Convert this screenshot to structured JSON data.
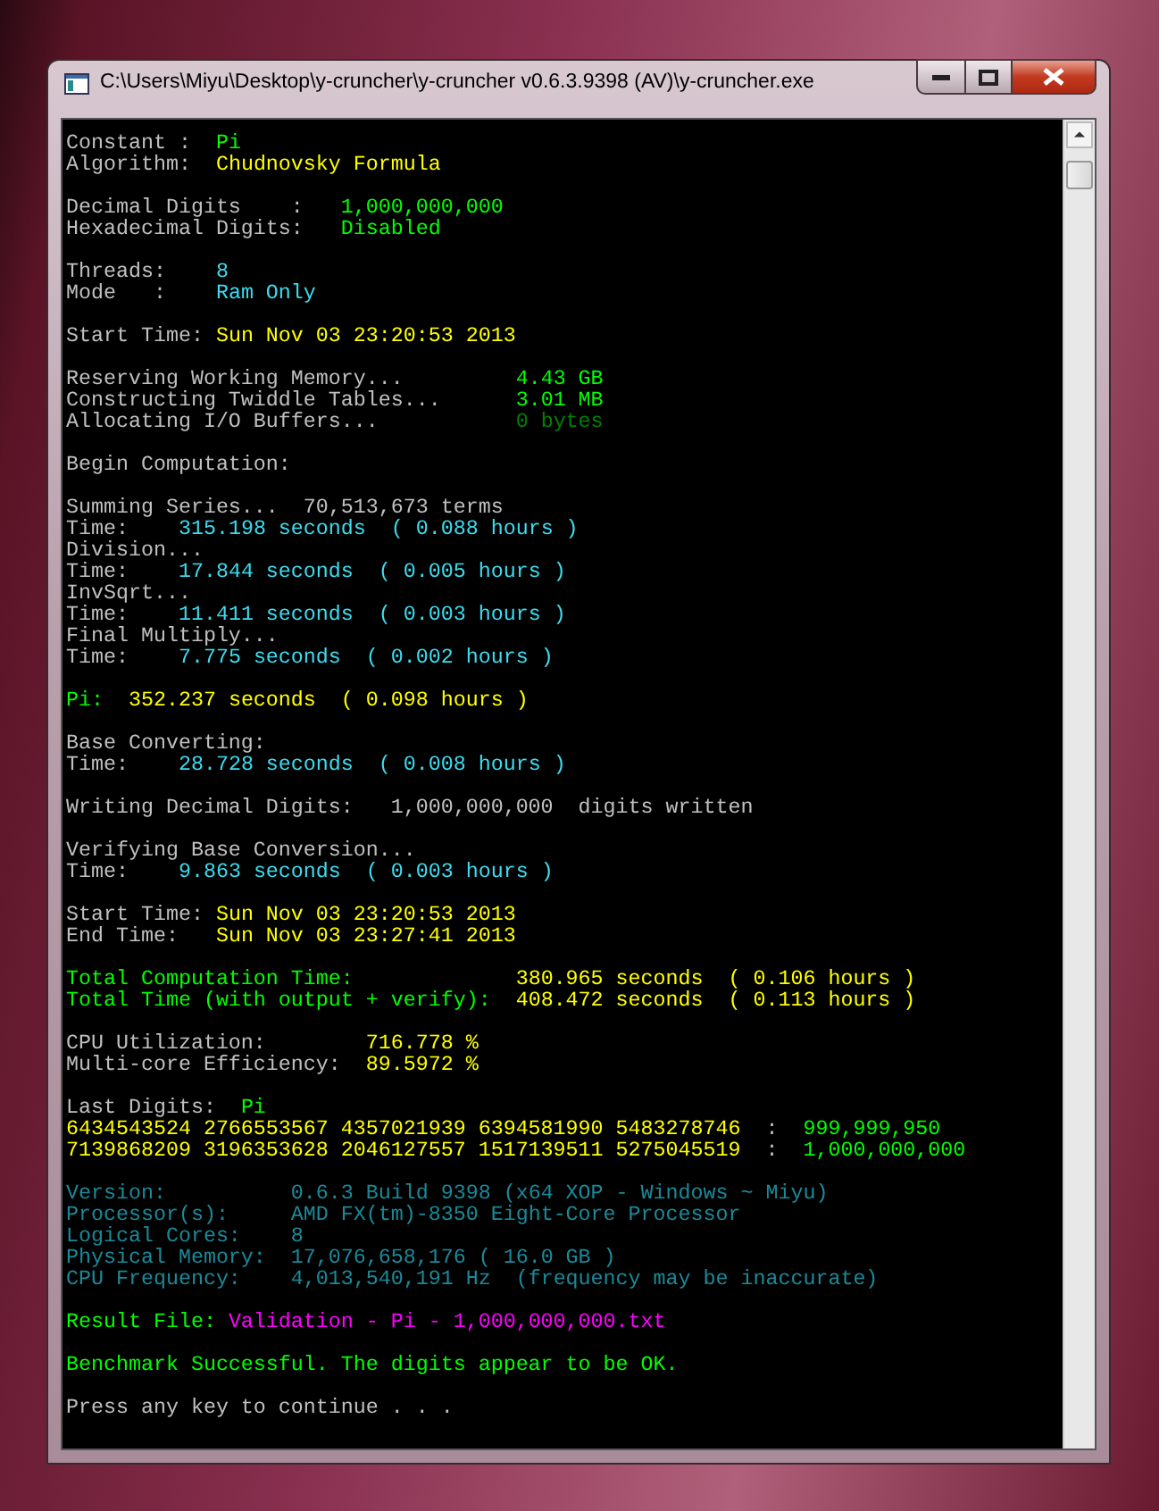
{
  "window": {
    "title": "C:\\Users\\Miyu\\Desktop\\y-cruncher\\y-cruncher v0.6.3.9398 (AV)\\y-cruncher.exe"
  },
  "console": {
    "blocks": [
      [
        [
          {
            "text": "Constant :  ",
            "color": "#c0c0c0"
          },
          {
            "text": "Pi",
            "color": "#00ff00"
          }
        ],
        [
          {
            "text": "Algorithm:  ",
            "color": "#c0c0c0"
          },
          {
            "text": "Chudnovsky Formula",
            "color": "#ffff00"
          }
        ]
      ],
      [
        [
          {
            "text": "Decimal Digits    :   ",
            "color": "#c0c0c0"
          },
          {
            "text": "1,000,000,000",
            "color": "#00ff00"
          }
        ],
        [
          {
            "text": "Hexadecimal Digits:   ",
            "color": "#c0c0c0"
          },
          {
            "text": "Disabled",
            "color": "#00ff00"
          }
        ]
      ],
      [
        [
          {
            "text": "Threads:    ",
            "color": "#c0c0c0"
          },
          {
            "text": "8",
            "color": "#3cdcf0"
          }
        ],
        [
          {
            "text": "Mode   :    ",
            "color": "#c0c0c0"
          },
          {
            "text": "Ram Only",
            "color": "#3cdcf0"
          }
        ]
      ],
      [
        [
          {
            "text": "Start Time: ",
            "color": "#c0c0c0"
          },
          {
            "text": "Sun Nov 03 23:20:53 2013",
            "color": "#ffff00"
          }
        ]
      ],
      [
        [
          {
            "text": "Reserving Working Memory...         ",
            "color": "#c0c0c0"
          },
          {
            "text": "4.43 GB",
            "color": "#00ff00"
          }
        ],
        [
          {
            "text": "Constructing Twiddle Tables...      ",
            "color": "#c0c0c0"
          },
          {
            "text": "3.01 MB",
            "color": "#00ff00"
          }
        ],
        [
          {
            "text": "Allocating I/O Buffers...           ",
            "color": "#c0c0c0"
          },
          {
            "text": "0 bytes",
            "color": "#008000"
          }
        ]
      ],
      [
        [
          {
            "text": "Begin Computation:",
            "color": "#c0c0c0"
          }
        ]
      ],
      [
        [
          {
            "text": "Summing Series...  70,513,673 terms",
            "color": "#c0c0c0"
          }
        ],
        [
          {
            "text": "Time:    ",
            "color": "#c0c0c0"
          },
          {
            "text": "315.198 seconds  ( 0.088 hours )",
            "color": "#3cdcf0"
          }
        ],
        [
          {
            "text": "Division...",
            "color": "#c0c0c0"
          }
        ],
        [
          {
            "text": "Time:    ",
            "color": "#c0c0c0"
          },
          {
            "text": "17.844 seconds  ( 0.005 hours )",
            "color": "#3cdcf0"
          }
        ],
        [
          {
            "text": "InvSqrt...",
            "color": "#c0c0c0"
          }
        ],
        [
          {
            "text": "Time:    ",
            "color": "#c0c0c0"
          },
          {
            "text": "11.411 seconds  ( 0.003 hours )",
            "color": "#3cdcf0"
          }
        ],
        [
          {
            "text": "Final Multiply...",
            "color": "#c0c0c0"
          }
        ],
        [
          {
            "text": "Time:    ",
            "color": "#c0c0c0"
          },
          {
            "text": "7.775 seconds  ( 0.002 hours )",
            "color": "#3cdcf0"
          }
        ]
      ],
      [
        [
          {
            "text": "Pi:  ",
            "color": "#00ff00"
          },
          {
            "text": "352.237 seconds  ( 0.098 hours )",
            "color": "#ffff00"
          }
        ]
      ],
      [
        [
          {
            "text": "Base Converting:",
            "color": "#c0c0c0"
          }
        ],
        [
          {
            "text": "Time:    ",
            "color": "#c0c0c0"
          },
          {
            "text": "28.728 seconds  ( 0.008 hours )",
            "color": "#3cdcf0"
          }
        ]
      ],
      [
        [
          {
            "text": "Writing Decimal Digits:   1,000,000,000  digits written",
            "color": "#c0c0c0"
          }
        ]
      ],
      [
        [
          {
            "text": "Verifying Base Conversion...",
            "color": "#c0c0c0"
          }
        ],
        [
          {
            "text": "Time:    ",
            "color": "#c0c0c0"
          },
          {
            "text": "9.863 seconds  ( 0.003 hours )",
            "color": "#3cdcf0"
          }
        ]
      ],
      [
        [
          {
            "text": "Start Time: ",
            "color": "#c0c0c0"
          },
          {
            "text": "Sun Nov 03 23:20:53 2013",
            "color": "#ffff00"
          }
        ],
        [
          {
            "text": "End Time:   ",
            "color": "#c0c0c0"
          },
          {
            "text": "Sun Nov 03 23:27:41 2013",
            "color": "#ffff00"
          }
        ]
      ],
      [
        [
          {
            "text": "Total Computation Time:             ",
            "color": "#00ff00"
          },
          {
            "text": "380.965 seconds  ( 0.106 hours )",
            "color": "#ffff00"
          }
        ],
        [
          {
            "text": "Total Time (with output + verify):  ",
            "color": "#00ff00"
          },
          {
            "text": "408.472 seconds  ( 0.113 hours )",
            "color": "#ffff00"
          }
        ]
      ],
      [
        [
          {
            "text": "CPU Utilization:        ",
            "color": "#c0c0c0"
          },
          {
            "text": "716.778 %",
            "color": "#ffff00"
          }
        ],
        [
          {
            "text": "Multi-core Efficiency:  ",
            "color": "#c0c0c0"
          },
          {
            "text": "89.5972 %",
            "color": "#ffff00"
          }
        ]
      ],
      [
        [
          {
            "text": "Last Digits:  ",
            "color": "#c0c0c0"
          },
          {
            "text": "Pi",
            "color": "#00ff00"
          }
        ],
        [
          {
            "text": "6434543524 2766553567 4357021939 6394581990 5483278746",
            "color": "#ffff00"
          },
          {
            "text": "  :  ",
            "color": "#c0c0c0"
          },
          {
            "text": "999,999,950",
            "color": "#00ff00"
          }
        ],
        [
          {
            "text": "7139868209 3196353628 2046127557 1517139511 5275045519",
            "color": "#ffff00"
          },
          {
            "text": "  :  ",
            "color": "#c0c0c0"
          },
          {
            "text": "1,000,000,000",
            "color": "#00ff00"
          }
        ]
      ],
      [
        [
          {
            "text": "Version:          ",
            "color": "#1a8a9a"
          },
          {
            "text": "0.6.3 Build 9398 (x64 XOP - Windows ~ Miyu)",
            "color": "#1a8a9a"
          }
        ],
        [
          {
            "text": "Processor(s):     ",
            "color": "#1a8a9a"
          },
          {
            "text": "AMD FX(tm)-8350 Eight-Core Processor",
            "color": "#1a8a9a"
          }
        ],
        [
          {
            "text": "Logical Cores:    ",
            "color": "#1a8a9a"
          },
          {
            "text": "8",
            "color": "#1a8a9a"
          }
        ],
        [
          {
            "text": "Physical Memory:  ",
            "color": "#1a8a9a"
          },
          {
            "text": "17,076,658,176 ( 16.0 GB )",
            "color": "#1a8a9a"
          }
        ],
        [
          {
            "text": "CPU Frequency:    ",
            "color": "#1a8a9a"
          },
          {
            "text": "4,013,540,191 Hz  (frequency may be inaccurate)",
            "color": "#1a8a9a"
          }
        ]
      ],
      [
        [
          {
            "text": "Result File: ",
            "color": "#00ff00"
          },
          {
            "text": "Validation - Pi - 1,000,000,000.txt",
            "color": "#ff00ff"
          }
        ]
      ],
      [
        [
          {
            "text": "Benchmark Successful. The digits appear to be OK.",
            "color": "#00ff00"
          }
        ]
      ],
      [
        [
          {
            "text": "Press any key to continue . . .",
            "color": "#c0c0c0"
          }
        ]
      ]
    ]
  }
}
